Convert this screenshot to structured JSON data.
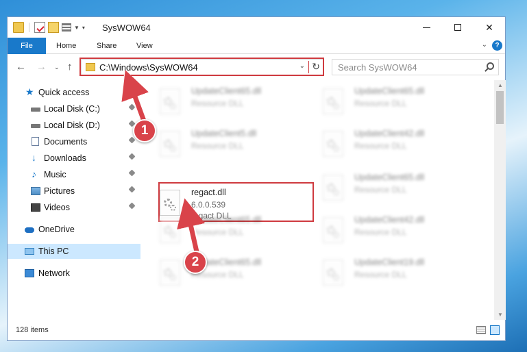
{
  "window": {
    "title": "SysWOW64",
    "controls": {
      "minimize": "—",
      "maximize": "□",
      "close": "✕"
    }
  },
  "ribbon": {
    "tabs": [
      "File",
      "Home",
      "Share",
      "View"
    ],
    "help_label": "?",
    "accent_color": "#1979ca"
  },
  "address": {
    "path": "C:\\Windows\\SysWOW64",
    "search_placeholder": "Search SysWOW64"
  },
  "sidebar": {
    "items": [
      {
        "label": "Quick access",
        "icon": "star-icon"
      },
      {
        "label": "Local Disk (C:)",
        "icon": "disk-icon"
      },
      {
        "label": "Local Disk (D:)",
        "icon": "disk-icon"
      },
      {
        "label": "Documents",
        "icon": "document-icon"
      },
      {
        "label": "Downloads",
        "icon": "download-icon"
      },
      {
        "label": "Music",
        "icon": "music-icon"
      },
      {
        "label": "Pictures",
        "icon": "pictures-icon"
      },
      {
        "label": "Videos",
        "icon": "videos-icon"
      },
      {
        "label": "OneDrive",
        "icon": "cloud-icon"
      },
      {
        "label": "This PC",
        "icon": "computer-icon",
        "selected": true
      },
      {
        "label": "Network",
        "icon": "network-icon"
      }
    ]
  },
  "files": {
    "highlighted": {
      "name": "regact.dll",
      "version": "6.0.0.539",
      "type": "regact DLL"
    },
    "blurred": [
      {
        "name": "UpdateClient65.dll",
        "type": "Resource DLL"
      },
      {
        "name": "UpdateClient65.dll",
        "type": "Resource DLL"
      },
      {
        "name": "UpdateClient5.dll",
        "type": "Resource DLL"
      },
      {
        "name": "UpdateClient42.dll",
        "type": "Resource DLL"
      },
      {
        "name": "UpdateClient65.dll",
        "type": "Resource DLL"
      },
      {
        "name": "UpdateClient65.dll",
        "type": "Resource DLL"
      },
      {
        "name": "UpdateClient42.dll",
        "type": "Resource DLL"
      },
      {
        "name": "UpdateClient65.dll",
        "type": "Resource DLL"
      },
      {
        "name": "UpdateClient19.dll",
        "type": "Resource DLL"
      }
    ]
  },
  "status": {
    "item_count": "128 items"
  },
  "annotations": {
    "step1": "1",
    "step2": "2",
    "color": "#d9434a"
  }
}
